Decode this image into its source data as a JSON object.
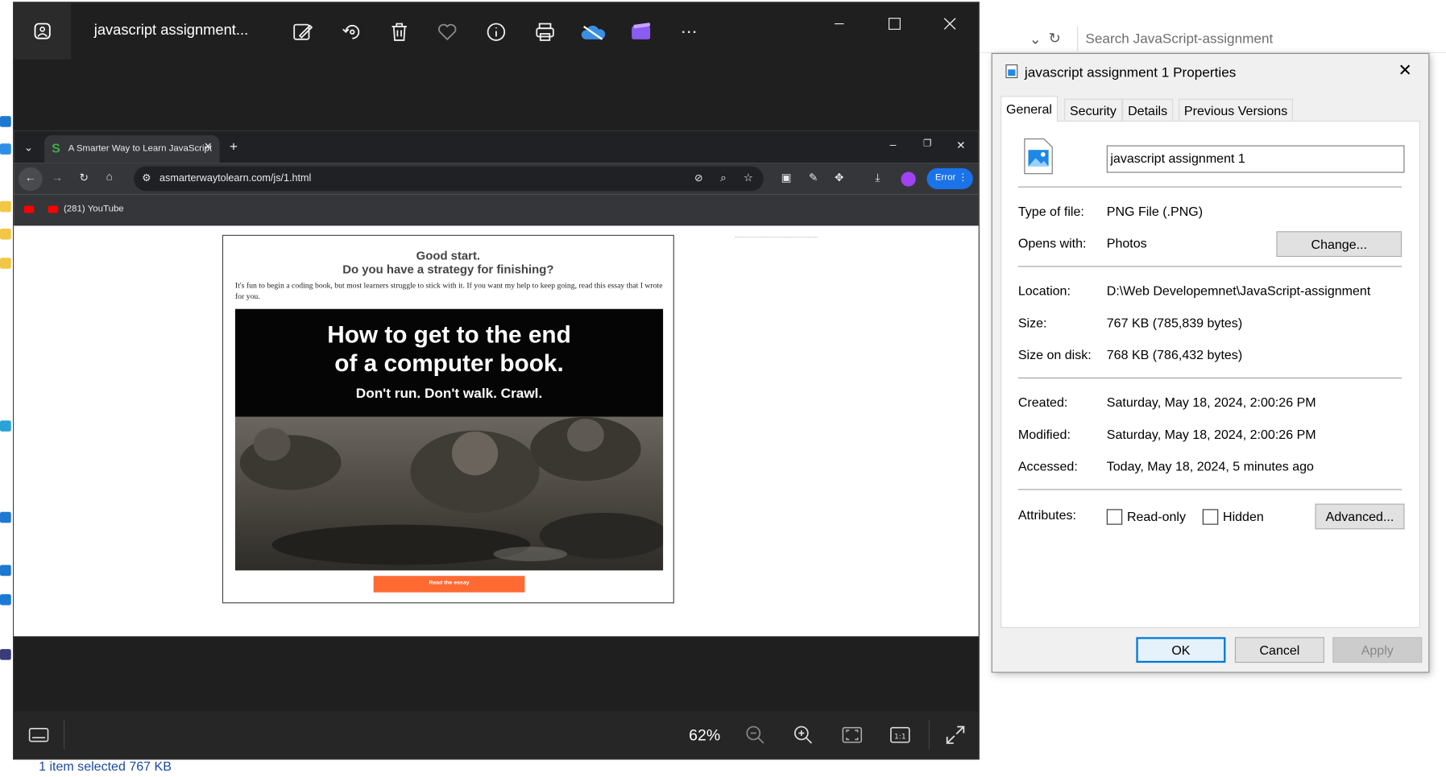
{
  "explorer": {
    "search_placeholder": "Search JavaScript-assignment",
    "status_text": "1 item selected  767 KB"
  },
  "photos": {
    "title": "javascript assignment...",
    "zoom": "62%",
    "toolbar": [
      "edit-image",
      "rotate",
      "delete",
      "favorite",
      "file-info",
      "print",
      "onedrive",
      "clipchamp",
      "more"
    ]
  },
  "browser": {
    "tab_title": "A Smarter Way to Learn JavaScript",
    "url": "asmarterwaytolearn.com/js/1.html",
    "bookmark": "(281) YouTube",
    "error_label": "Error",
    "page": {
      "heading_line1": "Good start.",
      "heading_line2": "Do you have a strategy for finishing?",
      "paragraph": "It's fun to begin a coding book, but most learners struggle to stick with it. If you want my help to keep going, read this essay that I wrote for you.",
      "banner_line1": "How to get to the end",
      "banner_line2": "of a computer book.",
      "banner_sub": "Don't run. Don't walk. Crawl.",
      "button": "Read the essay"
    }
  },
  "dialog": {
    "title": "javascript assignment 1 Properties",
    "tabs": [
      "General",
      "Security",
      "Details",
      "Previous Versions"
    ],
    "filename": "javascript assignment 1",
    "type_label": "Type of file:",
    "type_value": "PNG File (.PNG)",
    "opens_label": "Opens with:",
    "opens_value": "Photos",
    "change_button": "Change...",
    "location_label": "Location:",
    "location_value": "D:\\Web Developemnet\\JavaScript-assignment",
    "size_label": "Size:",
    "size_value": "767 KB (785,839 bytes)",
    "disk_label": "Size on disk:",
    "disk_value": "768 KB (786,432 bytes)",
    "created_label": "Created:",
    "created_value": "Saturday, May 18, 2024, 2:00:26 PM",
    "modified_label": "Modified:",
    "modified_value": "Saturday, May 18, 2024, 2:00:26 PM",
    "accessed_label": "Accessed:",
    "accessed_value": "Today, May 18, 2024, 5 minutes ago",
    "attributes_label": "Attributes:",
    "readonly_label": "Read-only",
    "hidden_label": "Hidden",
    "advanced_button": "Advanced...",
    "ok_button": "OK",
    "cancel_button": "Cancel",
    "apply_button": "Apply"
  }
}
